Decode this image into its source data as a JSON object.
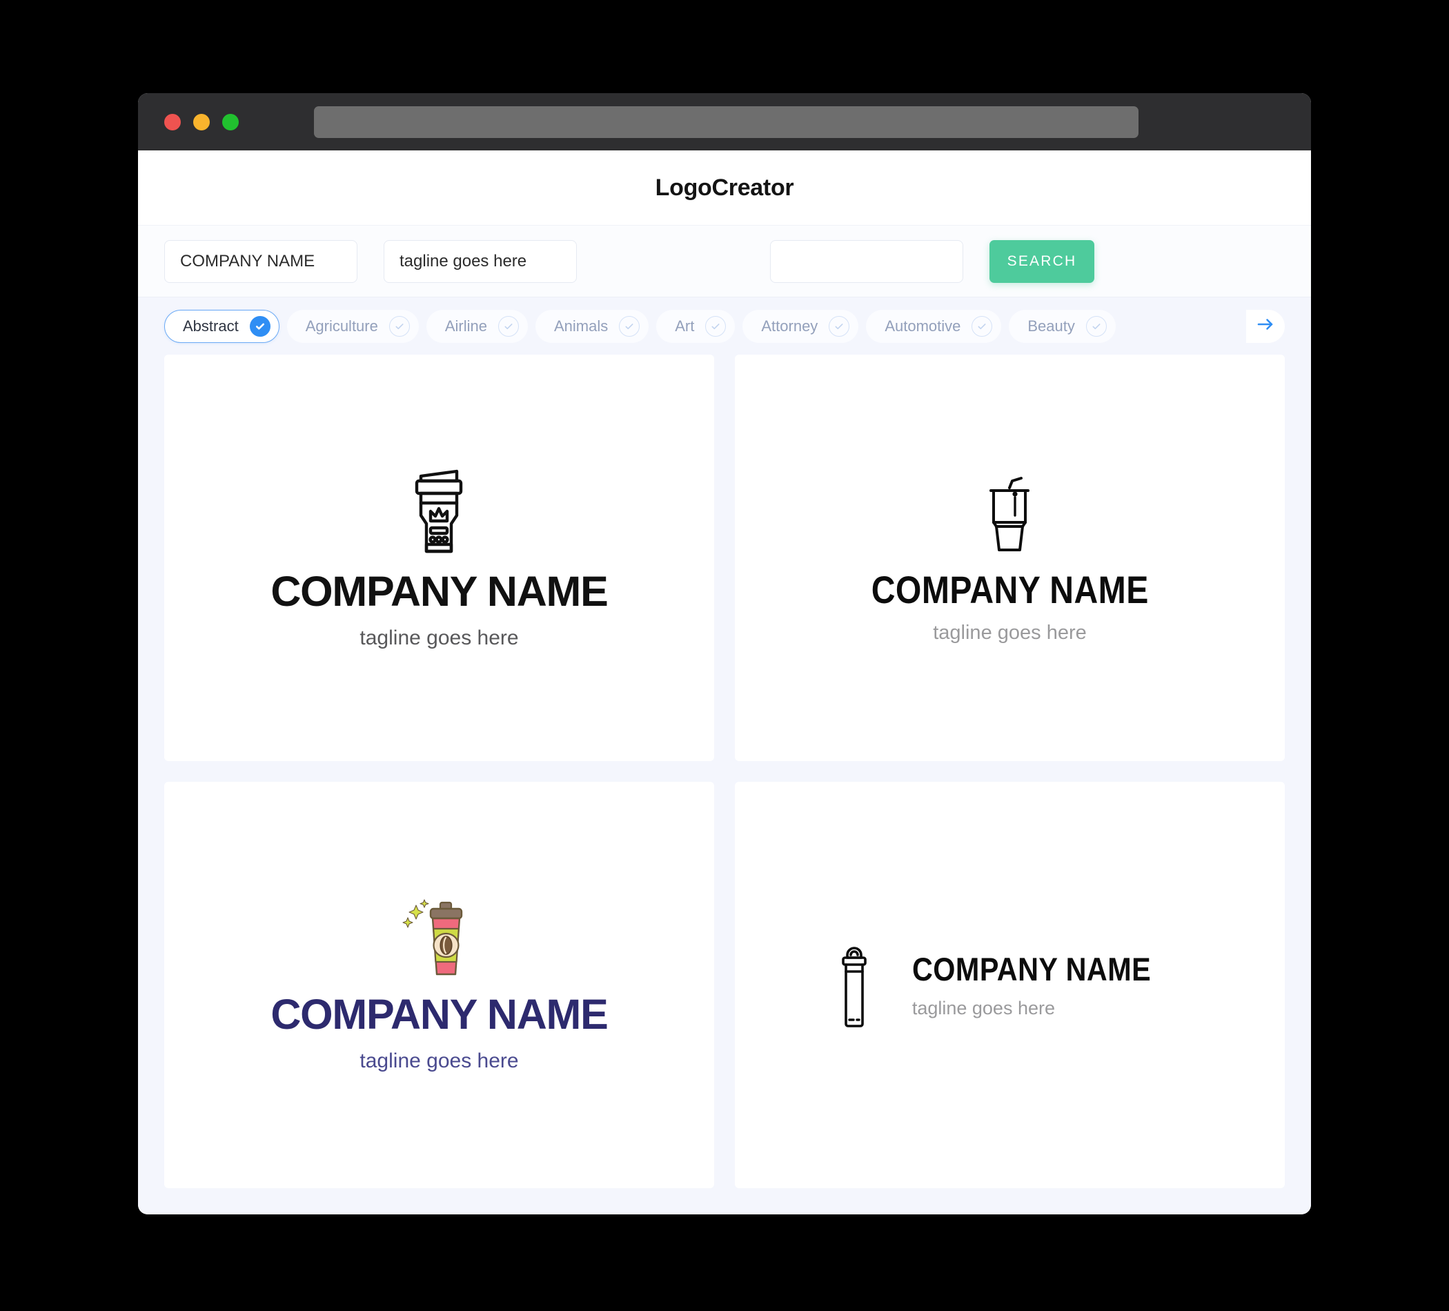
{
  "window": {
    "traffic_lights": [
      {
        "name": "close",
        "color": "#ef5350"
      },
      {
        "name": "minimize",
        "color": "#f9b42d"
      },
      {
        "name": "maximize",
        "color": "#21c12f"
      }
    ],
    "url_value": ""
  },
  "header": {
    "title": "LogoCreator"
  },
  "search": {
    "company_value": "COMPANY NAME",
    "company_placeholder": "COMPANY NAME",
    "tagline_value": "tagline goes here",
    "tagline_placeholder": "tagline goes here",
    "extra_value": "",
    "extra_placeholder": "",
    "button_label": "SEARCH",
    "button_color": "#4ecb9c"
  },
  "categories": {
    "accent_color": "#2f8ef4",
    "next_icon": "arrow-right-icon",
    "items": [
      {
        "label": "Abstract",
        "selected": true
      },
      {
        "label": "Agriculture",
        "selected": false
      },
      {
        "label": "Airline",
        "selected": false
      },
      {
        "label": "Animals",
        "selected": false
      },
      {
        "label": "Art",
        "selected": false
      },
      {
        "label": "Attorney",
        "selected": false
      },
      {
        "label": "Automotive",
        "selected": false
      },
      {
        "label": "Beauty",
        "selected": false
      }
    ]
  },
  "results": {
    "cards": [
      {
        "id": "card1",
        "icon": "blender-cup-crown-icon",
        "layout": "stacked",
        "name": "COMPANY NAME",
        "tagline": "tagline goes here",
        "name_color": "#111111",
        "tagline_color": "#58585a"
      },
      {
        "id": "card2",
        "icon": "cup-with-straw-icon",
        "layout": "stacked",
        "name": "COMPANY NAME",
        "tagline": "tagline goes here",
        "name_color": "#0c0c0c",
        "tagline_color": "#9a9a9c"
      },
      {
        "id": "card3",
        "icon": "coffee-cup-sparkle-icon",
        "layout": "stacked",
        "name": "COMPANY NAME",
        "tagline": "tagline goes here",
        "name_color": "#2d2a6e",
        "tagline_color": "#4a4a8f"
      },
      {
        "id": "card4",
        "icon": "thermos-bottle-icon",
        "layout": "horizontal",
        "name": "COMPANY NAME",
        "tagline": "tagline goes here",
        "name_color": "#0c0c0c",
        "tagline_color": "#9a9a9c"
      }
    ]
  }
}
